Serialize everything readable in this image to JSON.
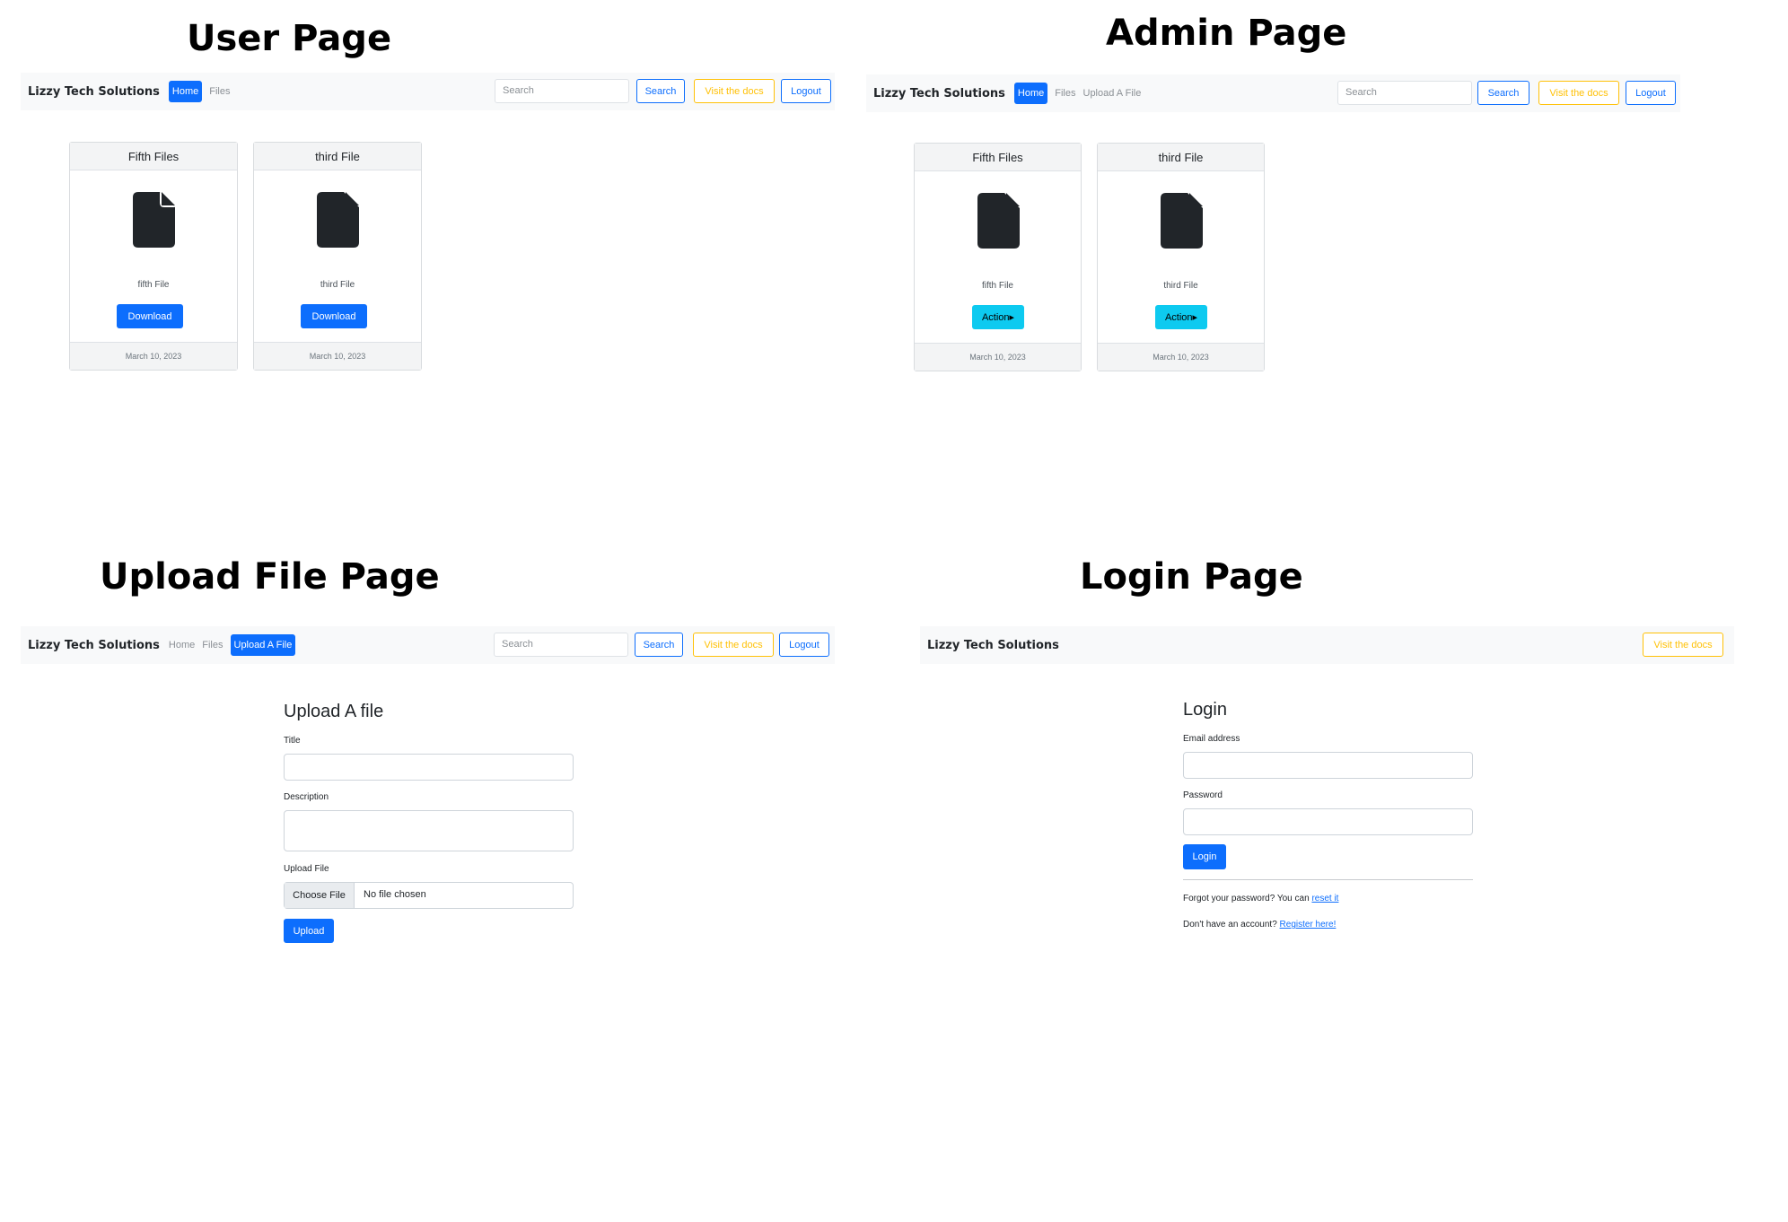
{
  "sections": {
    "user": "User Page",
    "admin": "Admin Page",
    "upload": "Upload File Page",
    "login": "Login Page"
  },
  "navbar": {
    "brand": "Lizzy Tech Solutions",
    "home": "Home",
    "files": "Files",
    "upload_link": "Upload A File",
    "search_placeholder": "Search",
    "search_button": "Search",
    "docs_button": "Visit the docs",
    "logout_button": "Logout"
  },
  "files": [
    {
      "title": "Fifth Files",
      "description": "fifth File",
      "date": "March 10, 2023"
    },
    {
      "title": "third File",
      "description": "third File",
      "date": "March 10, 2023"
    }
  ],
  "buttons": {
    "download": "Download",
    "action": "Action▸"
  },
  "upload_form": {
    "heading": "Upload A file",
    "title_label": "Title",
    "description_label": "Description",
    "file_label": "Upload File",
    "choose_file": "Choose File",
    "no_file": "No file chosen",
    "submit": "Upload"
  },
  "login_form": {
    "heading": "Login",
    "email_label": "Email address",
    "password_label": "Password",
    "submit": "Login",
    "forgot_text": "Forgot your password? You can ",
    "forgot_link": "reset it",
    "register_text": "Don't have an account? ",
    "register_link": "Register here!"
  },
  "icons": {
    "file": "file-icon"
  },
  "colors": {
    "primary": "#0d6efd",
    "info": "#0dcaf0",
    "warning": "#ffc107",
    "navbar_bg": "#f8f9fa"
  }
}
